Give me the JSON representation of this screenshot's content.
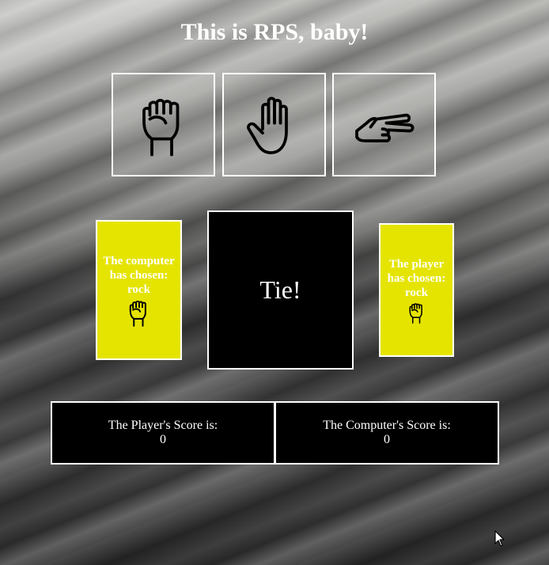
{
  "header": {
    "title": "This is RPS, baby!"
  },
  "choices": [
    {
      "id": "rock",
      "icon": "fist-icon"
    },
    {
      "id": "paper",
      "icon": "open-hand-icon"
    },
    {
      "id": "scissors",
      "icon": "two-finger-hand-icon"
    }
  ],
  "computer_card": {
    "text": "The computer has chosen: rock",
    "icon": "fist-icon"
  },
  "player_card": {
    "text": "The player has chosen: rock",
    "icon": "fist-icon"
  },
  "result": {
    "text": "Tie!"
  },
  "scores": {
    "player_label": "The Player's Score is:",
    "player_value": "0",
    "computer_label": "The Computer's Score is:",
    "computer_value": "0"
  },
  "colors": {
    "card_yellow": "#e5e400",
    "box_black": "#000000",
    "border_white": "#ffffff"
  }
}
